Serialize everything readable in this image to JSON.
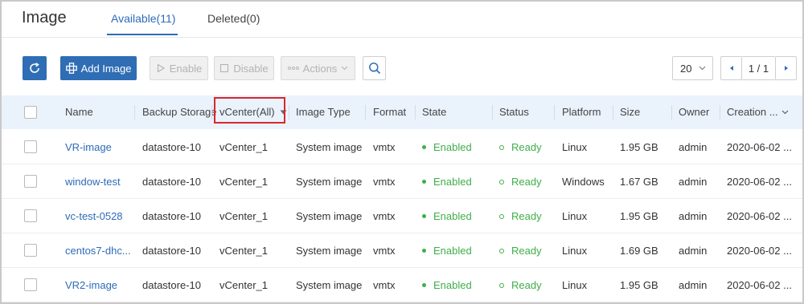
{
  "header": {
    "title": "Image",
    "tabs": [
      {
        "label": "Available(11)"
      },
      {
        "label": "Deleted(0)"
      }
    ]
  },
  "toolbar": {
    "add_label": "Add Image",
    "enable_label": "Enable",
    "disable_label": "Disable",
    "actions_label": "Actions",
    "page_size": "20",
    "pagination": "1 / 1"
  },
  "table": {
    "columns": [
      "Name",
      "Backup Storage",
      "vCenter(All)",
      "Image Type",
      "Format",
      "State",
      "Status",
      "Platform",
      "Size",
      "Owner",
      "Creation ..."
    ],
    "rows": [
      {
        "name": "VR-image",
        "backup": "datastore-10",
        "vcenter": "vCenter_1",
        "type": "System image",
        "format": "vmtx",
        "state": "Enabled",
        "status": "Ready",
        "platform": "Linux",
        "size": "1.95 GB",
        "owner": "admin",
        "created": "2020-06-02 ..."
      },
      {
        "name": "window-test",
        "backup": "datastore-10",
        "vcenter": "vCenter_1",
        "type": "System image",
        "format": "vmtx",
        "state": "Enabled",
        "status": "Ready",
        "platform": "Windows",
        "size": "1.67 GB",
        "owner": "admin",
        "created": "2020-06-02 ..."
      },
      {
        "name": "vc-test-0528",
        "backup": "datastore-10",
        "vcenter": "vCenter_1",
        "type": "System image",
        "format": "vmtx",
        "state": "Enabled",
        "status": "Ready",
        "platform": "Linux",
        "size": "1.95 GB",
        "owner": "admin",
        "created": "2020-06-02 ..."
      },
      {
        "name": "centos7-dhc...",
        "backup": "datastore-10",
        "vcenter": "vCenter_1",
        "type": "System image",
        "format": "vmtx",
        "state": "Enabled",
        "status": "Ready",
        "platform": "Linux",
        "size": "1.69 GB",
        "owner": "admin",
        "created": "2020-06-02 ..."
      },
      {
        "name": "VR2-image",
        "backup": "datastore-10",
        "vcenter": "vCenter_1",
        "type": "System image",
        "format": "vmtx",
        "state": "Enabled",
        "status": "Ready",
        "platform": "Linux",
        "size": "1.95 GB",
        "owner": "admin",
        "created": "2020-06-02 ..."
      }
    ]
  },
  "colors": {
    "primary": "#2f6db5",
    "link": "#2d6bb8",
    "status_green": "#3fae49",
    "header_bg": "#eaf2fc",
    "highlight_box": "#d9272e"
  },
  "icons": [
    "refresh-icon",
    "add-icon",
    "play-icon",
    "stop-icon",
    "more-icon",
    "chevron-down-icon",
    "search-icon",
    "caret-down-icon",
    "prev-page-icon",
    "next-page-icon"
  ]
}
